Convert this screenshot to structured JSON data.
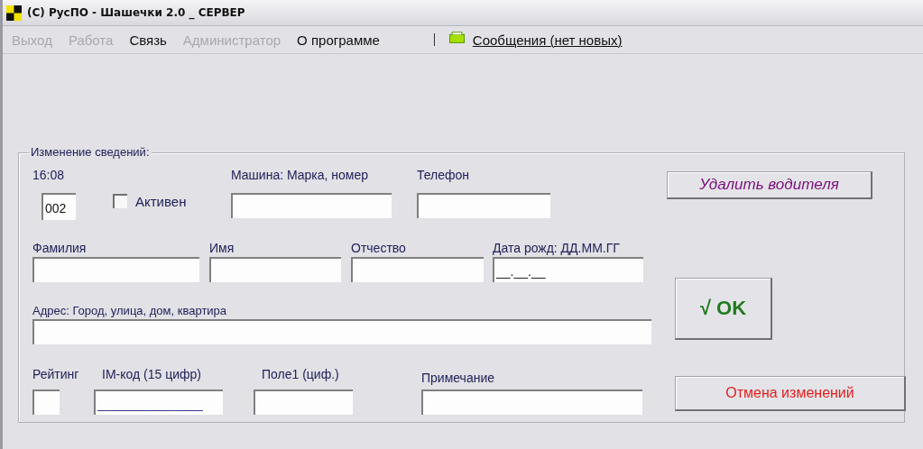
{
  "window": {
    "title": "(C) РусПО - Шашечки 2.0 _ СЕРВЕР"
  },
  "menu": [
    {
      "label": "Выход",
      "disabled": true
    },
    {
      "label": "Работа",
      "disabled": true
    },
    {
      "label": "Связь",
      "disabled": false
    },
    {
      "label": "Администратор",
      "disabled": true
    },
    {
      "label": "О программе",
      "disabled": false
    }
  ],
  "messages": {
    "label": "Сообщения (нет новых)"
  },
  "group": {
    "legend": "Изменение  сведений:",
    "time": "16:08",
    "number": {
      "value": "002"
    },
    "active": {
      "label": "Активен",
      "checked": false
    },
    "row1": [
      {
        "label": "Машина: Марка, номер"
      },
      {
        "label": "Телефон"
      }
    ],
    "row2": [
      {
        "label": "Фамилия"
      },
      {
        "label": "Имя"
      },
      {
        "label": "Отчество"
      },
      {
        "label": "Дата рожд: ДД.ММ.ГГ",
        "value": "__.__.__"
      }
    ],
    "address": {
      "label": "Адрес: Город, улица, дом, квартира"
    },
    "row4": [
      {
        "label": "Рейтинг"
      },
      {
        "label": "IM-код (15 цифр)",
        "value": "_______________"
      },
      {
        "label": "Поле1 (циф.)"
      },
      {
        "label": "Примечание"
      }
    ]
  },
  "buttons": {
    "delete": "Удалить водителя",
    "ok": "√ OK",
    "cancel": "Отмена изменений"
  }
}
